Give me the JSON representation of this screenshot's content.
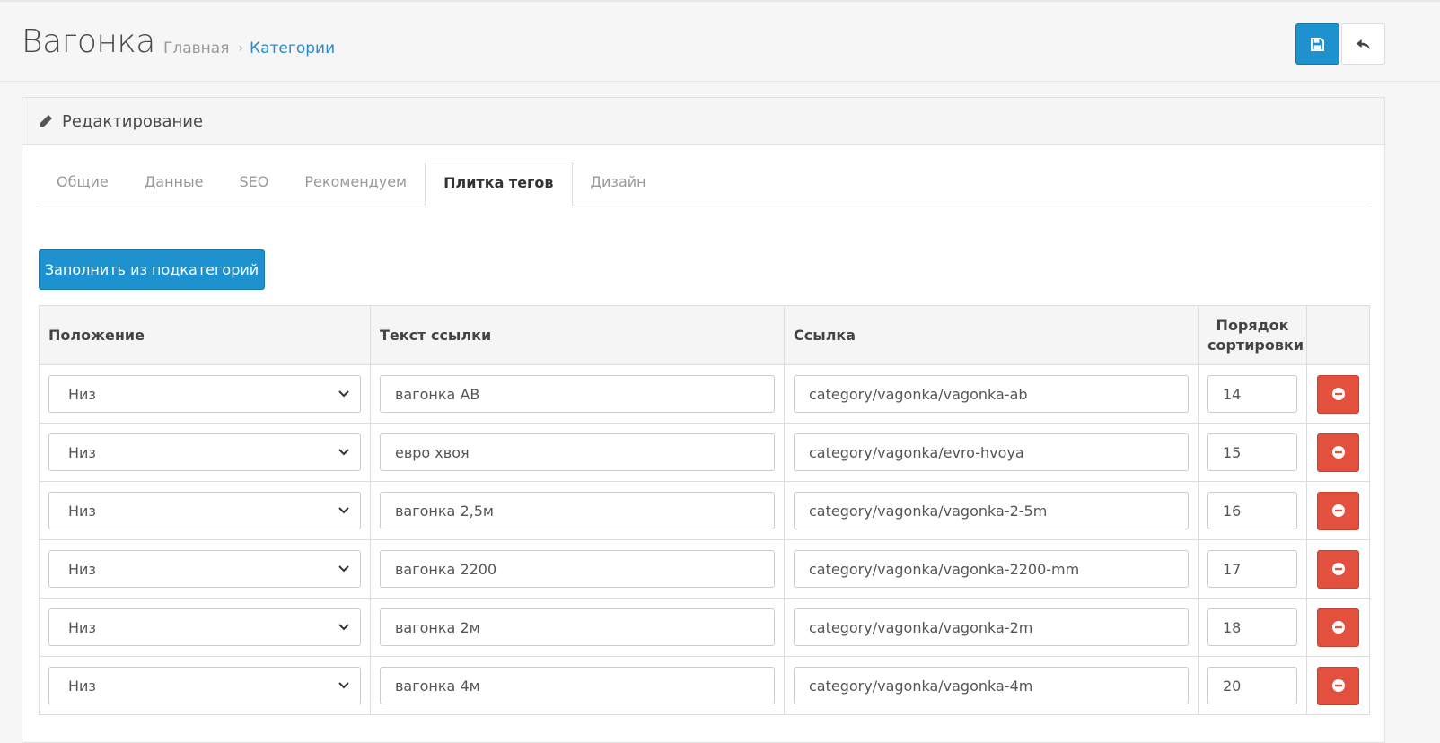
{
  "header": {
    "title": "Вагонка",
    "breadcrumb": {
      "home": "Главная",
      "separator": "›",
      "current": "Категории"
    }
  },
  "panel": {
    "title": "Редактирование"
  },
  "tabs": [
    {
      "label": "Общие"
    },
    {
      "label": "Данные"
    },
    {
      "label": "SEO"
    },
    {
      "label": "Рекомендуем"
    },
    {
      "label": "Плитка тегов"
    },
    {
      "label": "Дизайн"
    }
  ],
  "active_tab": "Плитка тегов",
  "fill_button": "Заполнить из подкатегорий",
  "table": {
    "headers": {
      "position": "Положение",
      "link_text": "Текст ссылки",
      "link": "Ссылка",
      "sort_line1": "Порядок",
      "sort_line2": "сортировки"
    },
    "rows": [
      {
        "position": "Низ",
        "text": "вагонка АВ",
        "link": "category/vagonka/vagonka-ab",
        "sort": "14"
      },
      {
        "position": "Низ",
        "text": "евро хвоя",
        "link": "category/vagonka/evro-hvoya",
        "sort": "15"
      },
      {
        "position": "Низ",
        "text": "вагонка 2,5м",
        "link": "category/vagonka/vagonka-2-5m",
        "sort": "16"
      },
      {
        "position": "Низ",
        "text": "вагонка 2200",
        "link": "category/vagonka/vagonka-2200-mm",
        "sort": "17"
      },
      {
        "position": "Низ",
        "text": "вагонка 2м",
        "link": "category/vagonka/vagonka-2m",
        "sort": "18"
      },
      {
        "position": "Низ",
        "text": "вагонка 4м",
        "link": "category/vagonka/vagonka-4m",
        "sort": "20"
      }
    ]
  },
  "icons": {
    "save": "save-icon",
    "back": "reply-icon",
    "edit": "pencil-icon",
    "remove": "minus-circle-icon",
    "select": "chevron-down-icon"
  },
  "colors": {
    "primary": "#1e91cf",
    "danger": "#e3503e",
    "link": "#2d8ac7"
  }
}
